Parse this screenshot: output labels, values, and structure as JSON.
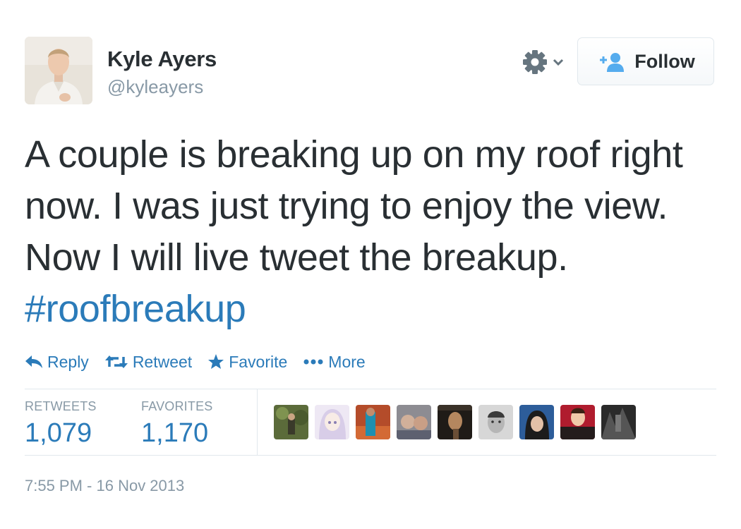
{
  "user": {
    "name": "Kyle Ayers",
    "handle": "@kyleayers"
  },
  "header": {
    "follow_label": "Follow",
    "gear_icon": "gear-icon",
    "follow_icon": "add-user-icon"
  },
  "tweet": {
    "text": "A couple is breaking up on my roof right now. I was just trying to enjoy the view. Now I will live tweet the breakup.",
    "hashtag": "#roofbreakup"
  },
  "actions": [
    {
      "label": "Reply",
      "icon": "reply-icon"
    },
    {
      "label": "Retweet",
      "icon": "retweet-icon"
    },
    {
      "label": "Favorite",
      "icon": "star-icon"
    },
    {
      "label": "More",
      "icon": "more-dots-icon"
    }
  ],
  "stats": {
    "retweets_label": "RETWEETS",
    "retweets_value": "1,079",
    "favorites_label": "FAVORITES",
    "favorites_value": "1,170"
  },
  "timestamp": "7:55 PM - 16 Nov 2013",
  "colors": {
    "link": "#2b7bb9",
    "text": "#292f33",
    "muted": "#8899a6",
    "border": "#e1e8ed"
  }
}
